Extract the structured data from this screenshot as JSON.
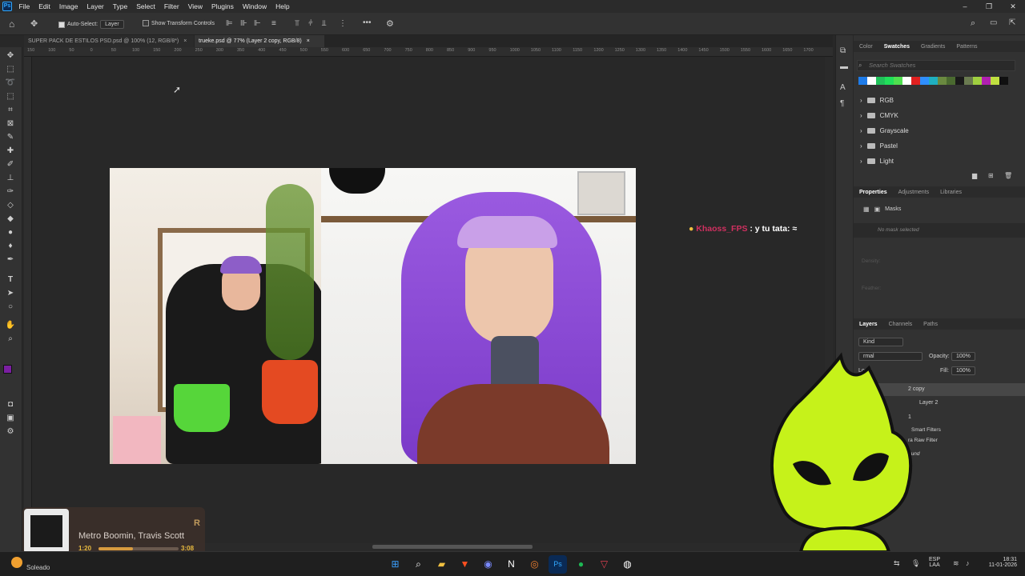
{
  "menu": {
    "logo": "Ps",
    "items": [
      "File",
      "Edit",
      "Image",
      "Layer",
      "Type",
      "Select",
      "Filter",
      "View",
      "Plugins",
      "Window",
      "Help"
    ],
    "window_buttons": [
      "–",
      "❐",
      "✕"
    ]
  },
  "options": {
    "auto_select_label": "Auto-Select:",
    "auto_select_value": "Layer",
    "transform_label": "Show Transform Controls",
    "more": "•••"
  },
  "doc_tabs": [
    {
      "title": "SUPER PACK DE ESTILOS PSD.psd @ 100% (12, RGB/8*)",
      "close": "×"
    },
    {
      "title": "trueke.psd @ 77% (Layer 2 copy, RGB/8)",
      "close": "×",
      "active": true
    }
  ],
  "rulers": {
    "h_ticks": [
      "150",
      "100",
      "50",
      "0",
      "50",
      "100",
      "150",
      "200",
      "250",
      "300",
      "350",
      "400",
      "450",
      "500",
      "550",
      "600",
      "650",
      "700",
      "750",
      "800",
      "850",
      "900",
      "950",
      "1000",
      "1050",
      "1100",
      "1150",
      "1200",
      "1250",
      "1300",
      "1350",
      "1400",
      "1450",
      "1500",
      "1550",
      "1600",
      "1650",
      "1700"
    ]
  },
  "swatches_panel": {
    "tabs": [
      "Color",
      "Swatches",
      "Gradients",
      "Patterns"
    ],
    "active_tab": "Swatches",
    "search_placeholder": "Search Swatches",
    "colors": [
      "#1e7be8",
      "#ffffff",
      "#21c25a",
      "#21e05a",
      "#4fe04f",
      "#ffffff",
      "#e02020",
      "#2f8fff",
      "#1fb0c0",
      "#6a8a40",
      "#4a6a30",
      "#1a1a1a",
      "#6a7a50",
      "#a0d040",
      "#b020b0",
      "#c0e040",
      "#101010"
    ],
    "groups": [
      "RGB",
      "CMYK",
      "Grayscale",
      "Pastel",
      "Light"
    ]
  },
  "properties_panel": {
    "tabs": [
      "Properties",
      "Adjustments",
      "Libraries"
    ],
    "title": "Masks",
    "mask_status": "No mask selected",
    "density_label": "Density:",
    "feather_label": "Feather:"
  },
  "layers_panel": {
    "tabs": [
      "Layers",
      "Channels",
      "Paths"
    ],
    "filter_value": "Kind",
    "blend_mode": "rmal",
    "opacity_label": "Opacity:",
    "opacity_value": "100%",
    "lock_label": "Lock:",
    "fill_label": "Fill:",
    "fill_value": "100%",
    "layers": [
      "2 copy",
      "Layer 2",
      "1",
      "Smart Filters",
      "ra Raw Filter",
      "ound"
    ]
  },
  "chat": {
    "user": "Khaoss_FPS",
    "message": ": y tu tata:"
  },
  "now_playing": {
    "artist": "Metro Boomin, Travis Scott",
    "elapsed": "1:20",
    "duration": "3:08",
    "progress": 0.43,
    "title_fragment": "R"
  },
  "weather": {
    "label": "Soleado"
  },
  "tray": {
    "lang": "ESP",
    "lang2": "LAA",
    "time": "18:31",
    "date": "11-01-2026"
  },
  "colors": {
    "fg_swatch": "#7b1fa2",
    "bg_swatch": "#ffffff",
    "mascot": "#c6f21a"
  }
}
